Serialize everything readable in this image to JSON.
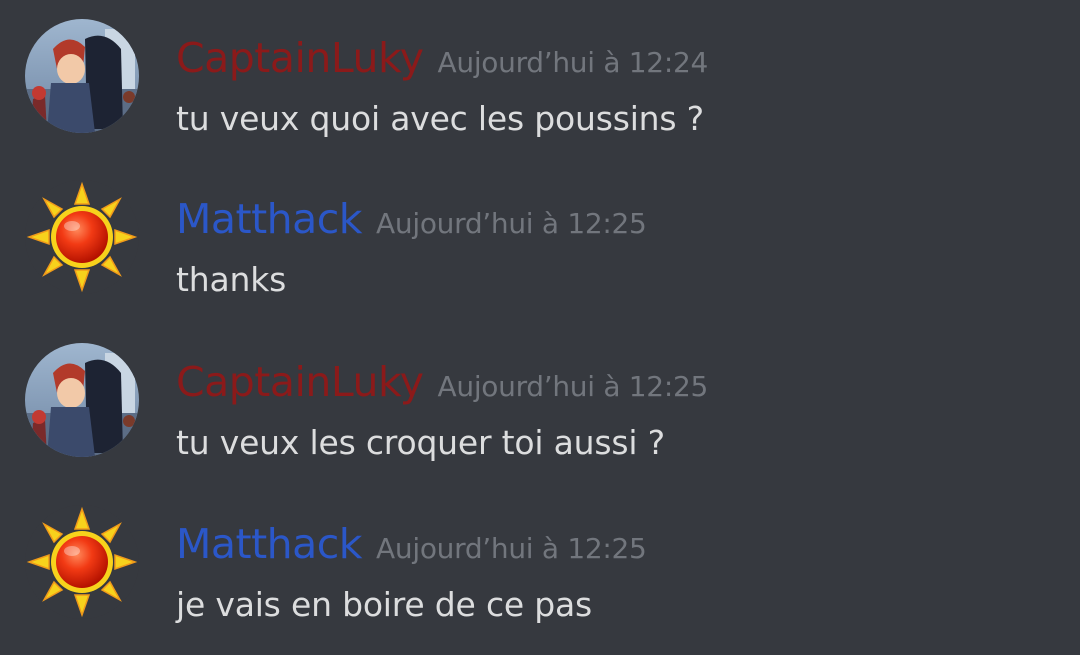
{
  "colors": {
    "background": "#36393f",
    "text": "#dcddde",
    "timestamp": "#72767d"
  },
  "messages": [
    {
      "author": "CaptainLuky",
      "author_color": "#8b1a1a",
      "avatar_icon": "anime-characters-avatar",
      "timestamp": "Aujourd’hui à 12:24",
      "text": "tu veux quoi avec les poussins ?"
    },
    {
      "author": "Matthack",
      "author_color": "#2b57c8",
      "avatar_icon": "sun-emoji-avatar",
      "timestamp": "Aujourd’hui à 12:25",
      "text": "thanks"
    },
    {
      "author": "CaptainLuky",
      "author_color": "#8b1a1a",
      "avatar_icon": "anime-characters-avatar",
      "timestamp": "Aujourd’hui à 12:25",
      "text": "tu veux les croquer toi aussi ?"
    },
    {
      "author": "Matthack",
      "author_color": "#2b57c8",
      "avatar_icon": "sun-emoji-avatar",
      "timestamp": "Aujourd’hui à 12:25",
      "text": "je vais en boire de ce pas"
    }
  ]
}
